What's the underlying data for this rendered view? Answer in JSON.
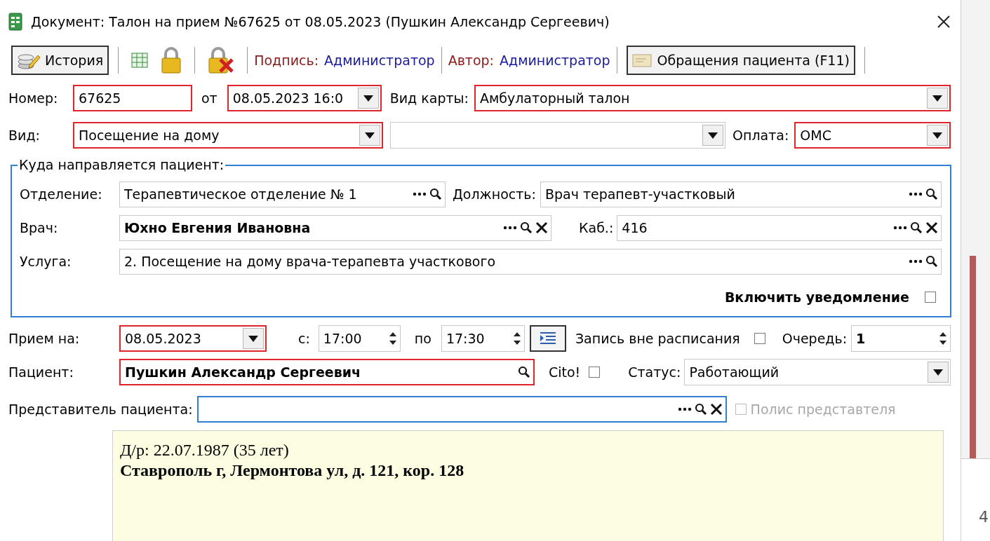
{
  "window": {
    "title": "Документ: Талон на прием №67625 от 08.05.2023 (Пушкин Александр Сергеевич)"
  },
  "toolbar": [
    {
      "kind": "button",
      "label": "История"
    },
    {
      "kind": "separator"
    },
    {
      "kind": "icon"
    },
    {
      "kind": "icon"
    },
    {
      "kind": "separator"
    },
    {
      "kind": "icon"
    },
    {
      "kind": "separator"
    },
    {
      "kind": "info",
      "label": "Подпись:",
      "value": "Администратор"
    },
    {
      "kind": "separator"
    },
    {
      "kind": "info",
      "label": "Автор:",
      "value": "Администратор"
    },
    {
      "kind": "separator"
    },
    {
      "kind": "button",
      "label": "Обращения пациента (F11)"
    },
    {
      "kind": "separator"
    }
  ],
  "number": {
    "label": "Номер:",
    "kind": "text",
    "value": "67625",
    "required": true
  },
  "date": {
    "label": "от",
    "kind": "combo",
    "value": "08.05.2023 16:0",
    "required": true
  },
  "card_type": {
    "label": "Вид карты:",
    "kind": "combo",
    "value": "Амбулаторный талон",
    "required": true
  },
  "visit_type": {
    "label": "Вид:",
    "kind": "combo",
    "value": "Посещение на дому",
    "required": true
  },
  "combo_2": {
    "kind": "combo",
    "required": false
  },
  "payment": {
    "label": "Оплата:",
    "kind": "combo",
    "value": "ОМС",
    "required": true
  },
  "referral": {
    "title": "Куда направляется пациент:",
    "department": {
      "label": "Отделение:",
      "kind": "lookup",
      "value": "Терапевтическое отделение № 1"
    },
    "position": {
      "label": "Должность:",
      "kind": "lookup",
      "value": "Врач терапевт-участковый"
    },
    "doctor": {
      "label": "Врач:",
      "kind": "lookup_clear",
      "value": "Юхно Евгения Ивановна",
      "bold": true
    },
    "room": {
      "label": "Каб.:",
      "kind": "lookup_clear",
      "value": "416"
    },
    "service": {
      "label": "Услуга:",
      "kind": "lookup",
      "value": "2. Посещение на дому врача-терапевта участкового"
    },
    "notify": {
      "label": "Включить уведомление",
      "checked": false
    }
  },
  "appointment": {
    "label": "Прием на:",
    "date": {
      "kind": "combo",
      "value": "08.05.2023",
      "required": true
    },
    "from": {
      "label": "с:",
      "kind": "spin",
      "value": "17:00"
    },
    "to": {
      "label": "по",
      "kind": "spin",
      "value": "17:30"
    },
    "off_schedule": {
      "label": "Запись вне расписания",
      "checked": false
    },
    "queue": {
      "label": "Очередь:",
      "kind": "spin",
      "value": "1",
      "bold": true
    }
  },
  "patient": {
    "label": "Пациент:",
    "kind": "search",
    "value": "Пушкин Александр Сергеевич",
    "bold": true,
    "required": true
  },
  "cito": {
    "label": "Cito!",
    "checked": false
  },
  "status": {
    "label": "Статус:",
    "kind": "combo",
    "value": "Работающий",
    "required": false
  },
  "representative": {
    "label": "Представитель пациента:",
    "kind": "lookup_clear",
    "focused": true
  },
  "representative_policy": {
    "label": "Полис представтеля",
    "checked": false,
    "disabled": true
  },
  "patient_info": {
    "birth": "Д/р: 22.07.1987 (35 лет)",
    "address": "Ставрополь г, Лермонтова ул, д. 121, кор. 128"
  },
  "background": {
    "page_number": "4"
  }
}
